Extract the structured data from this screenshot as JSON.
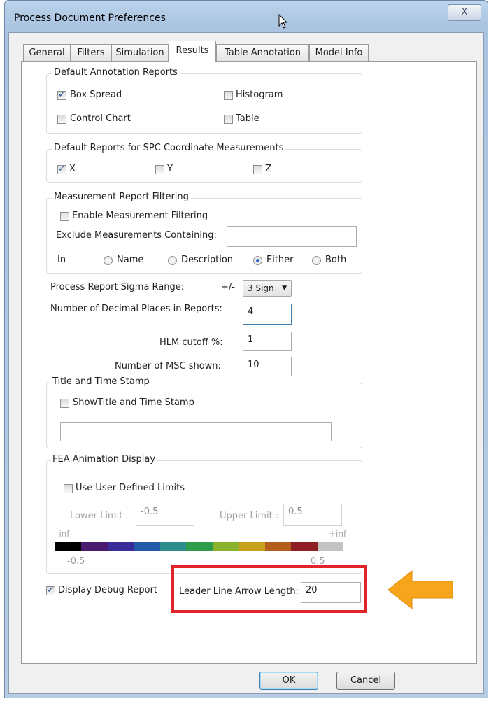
{
  "window": {
    "title": "Process Document Preferences",
    "close_label": "X"
  },
  "tabs": [
    {
      "label": "General"
    },
    {
      "label": "Filters"
    },
    {
      "label": "Simulation"
    },
    {
      "label": "Results"
    },
    {
      "label": "Table Annotation"
    },
    {
      "label": "Model Info"
    }
  ],
  "default_annotation_reports": {
    "title": "Default Annotation Reports",
    "box_spread": {
      "label": "Box Spread",
      "checked": true
    },
    "histogram": {
      "label": "Histogram",
      "checked": false
    },
    "control_chart": {
      "label": "Control Chart",
      "checked": false
    },
    "table": {
      "label": "Table",
      "checked": false
    }
  },
  "spc_reports": {
    "title": "Default Reports for SPC Coordinate Measurements",
    "x": {
      "label": "X",
      "checked": true
    },
    "y": {
      "label": "Y",
      "checked": false
    },
    "z": {
      "label": "Z",
      "checked": false
    }
  },
  "measurement_filtering": {
    "title": "Measurement Report Filtering",
    "enable": {
      "label": "Enable Measurement Filtering",
      "checked": false
    },
    "exclude_label": "Exclude Measurements Containing:",
    "exclude_value": "",
    "in_label": "In",
    "options": [
      "Name",
      "Description",
      "Either",
      "Both"
    ],
    "selected": "Either"
  },
  "sigma": {
    "label": "Process Report Sigma Range:",
    "plusminus": "+/-",
    "value": "3 Sign"
  },
  "decimal_places": {
    "label": "Number of Decimal Places in Reports:",
    "value": "4"
  },
  "hlm": {
    "label": "HLM cutoff %:",
    "value": "1"
  },
  "msc": {
    "label": "Number of MSC shown:",
    "value": "10"
  },
  "title_stamp": {
    "title": "Title and Time Stamp",
    "show": {
      "label": "ShowTitle and Time Stamp",
      "checked": false
    },
    "text_value": ""
  },
  "fea": {
    "title": "FEA Animation Display",
    "use_limits": {
      "label": "Use User Defined Limits",
      "checked": false
    },
    "lower_label": "Lower Limit :",
    "lower_value": "-0.5",
    "upper_label": "Upper Limit :",
    "upper_value": "0.5",
    "neg_inf": "-inf",
    "pos_inf": "+inf",
    "scale_min": "-0.5",
    "scale_max": "0.5",
    "colors": [
      "#000000",
      "#4b1a70",
      "#3a2b9a",
      "#2259a8",
      "#2d8b8d",
      "#2f9b4b",
      "#8ab22c",
      "#c8a21f",
      "#b55d1c",
      "#8f1f22",
      "#c3c3c3"
    ]
  },
  "debug": {
    "label": "Display Debug Report",
    "checked": true
  },
  "leader_line": {
    "label": "Leader Line Arrow Length:",
    "value": "20"
  },
  "buttons": {
    "ok": "OK",
    "cancel": "Cancel"
  },
  "accents": {
    "highlight_box": "#e0242a",
    "arrow": "#f7a51c"
  }
}
